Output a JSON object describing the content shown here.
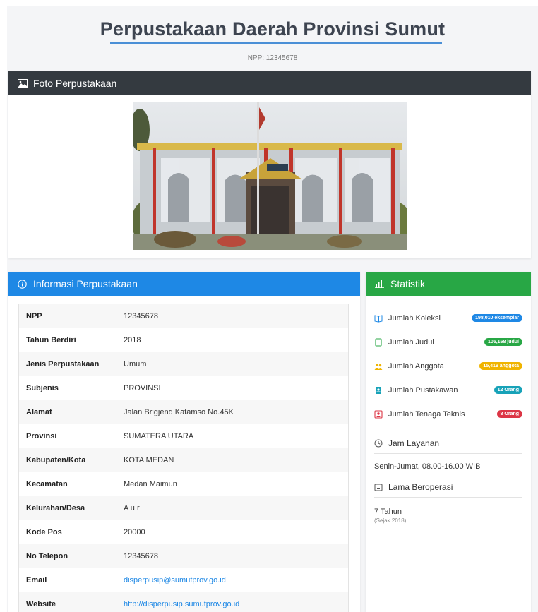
{
  "header": {
    "title": "Perpustakaan Daerah Provinsi Sumut",
    "npp": "NPP: 12345678"
  },
  "foto": {
    "title": "Foto Perpustakaan",
    "icon": "image-icon"
  },
  "info": {
    "title": "Informasi Perpustakaan",
    "icon": "info-circle-icon",
    "rows": [
      {
        "label": "NPP",
        "value": "12345678"
      },
      {
        "label": "Tahun Berdiri",
        "value": "2018"
      },
      {
        "label": "Jenis Perpustakaan",
        "value": "Umum"
      },
      {
        "label": "Subjenis",
        "value": "PROVINSI"
      },
      {
        "label": "Alamat",
        "value": "Jalan Brigjend Katamso No.45K"
      },
      {
        "label": "Provinsi",
        "value": "SUMATERA UTARA"
      },
      {
        "label": "Kabupaten/Kota",
        "value": "KOTA MEDAN"
      },
      {
        "label": "Kecamatan",
        "value": "Medan Maimun"
      },
      {
        "label": "Kelurahan/Desa",
        "value": "A u r"
      },
      {
        "label": "Kode Pos",
        "value": "20000"
      },
      {
        "label": "No Telepon",
        "value": "12345678"
      },
      {
        "label": "Email",
        "value": "disperpusip@sumutprov.go.id"
      },
      {
        "label": "Website",
        "value": "http://disperpusip.sumutprov.go.id"
      }
    ]
  },
  "statistik": {
    "title": "Statistik",
    "icon": "bar-chart-icon",
    "items": [
      {
        "label": "Jumlah Koleksi",
        "badge": "198,010 eksemplar",
        "color": "#1e88e5"
      },
      {
        "label": "Jumlah Judul",
        "badge": "105,168 judul",
        "color": "#28a745"
      },
      {
        "label": "Jumlah Anggota",
        "badge": "15,419 anggota",
        "color": "#f0b400"
      },
      {
        "label": "Jumlah Pustakawan",
        "badge": "12 Orang",
        "color": "#17a2b8"
      },
      {
        "label": "Jumlah Tenaga Teknis",
        "badge": "8 Orang",
        "color": "#dc3545"
      }
    ],
    "jam_title": "Jam Layanan",
    "jam_value": "Senin-Jumat, 08.00-16.00 WIB",
    "lama_title": "Lama Beroperasi",
    "lama_value": "7 Tahun",
    "lama_since": "(Sejak 2018)"
  }
}
